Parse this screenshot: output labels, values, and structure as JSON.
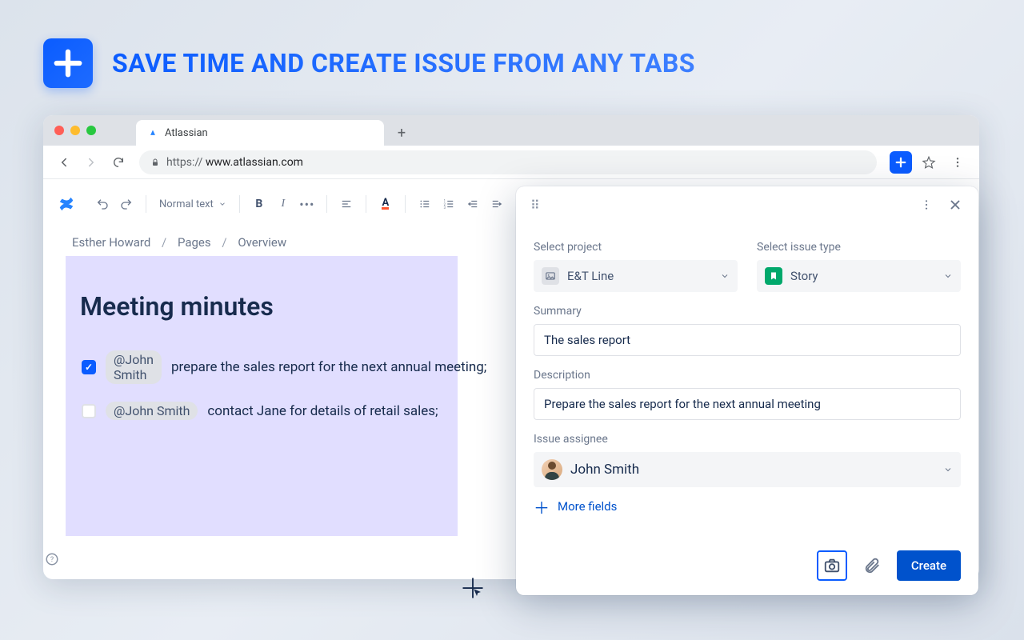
{
  "banner": {
    "text": "SAVE TIME AND CREATE ISSUE FROM ANY TABS"
  },
  "browser": {
    "tab_title": "Atlassian",
    "url_scheme": "https://",
    "url_host": "www.atlassian.com"
  },
  "editor": {
    "text_style": "Normal text",
    "breadcrumbs": [
      "Esther Howard",
      "Pages",
      "Overview"
    ],
    "doc_title": "Meeting minutes",
    "tasks": [
      {
        "checked": true,
        "mention": "@John Smith",
        "text": "prepare the sales report for the next annual meeting;"
      },
      {
        "checked": false,
        "mention": "@John Smith",
        "text": "contact Jane for details of retail sales;"
      }
    ]
  },
  "panel": {
    "project_label": "Select project",
    "issuetype_label": "Select issue type",
    "project_value": "E&T Line",
    "issuetype_value": "Story",
    "summary_label": "Summary",
    "summary_value": "The sales report",
    "description_label": "Description",
    "description_value": "Prepare the sales report for the next annual meeting",
    "assignee_label": "Issue assignee",
    "assignee_value": "John Smith",
    "more_fields": "More fields",
    "create": "Create"
  }
}
